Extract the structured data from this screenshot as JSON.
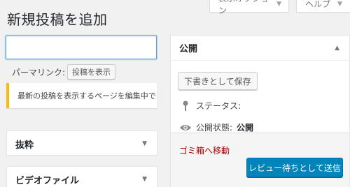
{
  "screen_options": {
    "label": "表示オプション"
  },
  "help": {
    "label": "ヘルプ"
  },
  "page_title": "新規投稿を追加",
  "title_input": {
    "value": "",
    "placeholder": ""
  },
  "permalink": {
    "label": "パーマリンク:",
    "view_button": "投稿を表示"
  },
  "notice": {
    "text": "最新の投稿を表示するページを編集中です。"
  },
  "excerpt": {
    "title": "抜粋"
  },
  "video_file": {
    "title": "ビデオファイル"
  },
  "publish": {
    "title": "公開",
    "save_draft": "下書きとして保存",
    "status_label": "ステータス:",
    "visibility_label": "公開状態:",
    "visibility_value": "公開",
    "trash_link": "ゴミ箱へ移動",
    "submit_review": "レビュー待ちとして送信"
  },
  "colors": {
    "accent": "#0085ba",
    "trash": "#aa0000",
    "notice_border": "#ffb900",
    "focus": "#5b9dd9"
  },
  "icons": [
    "chevron-down-icon",
    "chevron-up-icon",
    "pin-icon",
    "eye-icon"
  ]
}
